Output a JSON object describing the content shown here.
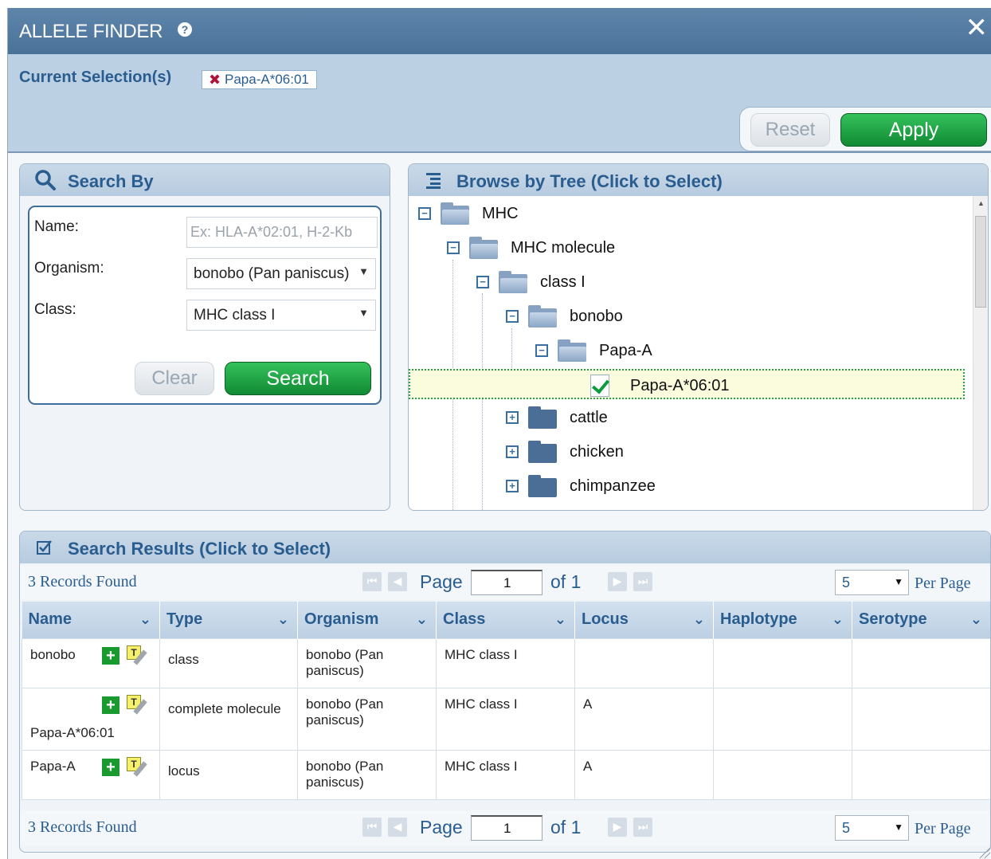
{
  "dialog": {
    "title": "ALLELE FINDER"
  },
  "selection": {
    "label": "Current Selection(s)",
    "chips": [
      "Papa-A*06:01"
    ]
  },
  "actions": {
    "reset": "Reset",
    "apply": "Apply"
  },
  "search_by": {
    "title": "Search By",
    "name_label": "Name:",
    "name_placeholder": "Ex: HLA-A*02:01, H-2-Kb",
    "name_value": "",
    "organism_label": "Organism:",
    "organism_value": "bonobo (Pan paniscus)",
    "class_label": "Class:",
    "class_value": "MHC class I",
    "clear": "Clear",
    "search": "Search"
  },
  "tree": {
    "title": "Browse by Tree (Click to Select)",
    "nodes": [
      {
        "label": "MHC",
        "level": 0,
        "state": "expanded"
      },
      {
        "label": "MHC molecule",
        "level": 1,
        "state": "expanded"
      },
      {
        "label": "class I",
        "level": 2,
        "state": "expanded"
      },
      {
        "label": "bonobo",
        "level": 3,
        "state": "expanded"
      },
      {
        "label": "Papa-A",
        "level": 4,
        "state": "expanded"
      },
      {
        "label": "Papa-A*06:01",
        "level": 5,
        "state": "leaf-selected"
      },
      {
        "label": "cattle",
        "level": 3,
        "state": "collapsed"
      },
      {
        "label": "chicken",
        "level": 3,
        "state": "collapsed"
      },
      {
        "label": "chimpanzee",
        "level": 3,
        "state": "collapsed"
      }
    ]
  },
  "results": {
    "title": "Search Results (Click to Select)",
    "records_found": "3 Records Found",
    "page_label": "Page",
    "page_value": "1",
    "of_label": "of 1",
    "per_page_value": "5",
    "per_page_label": "Per Page",
    "columns": [
      "Name",
      "Type",
      "Organism",
      "Class",
      "Locus",
      "Haplotype",
      "Serotype"
    ],
    "rows": [
      {
        "name": "bonobo",
        "type": "class",
        "organism": "bonobo (Pan paniscus)",
        "class": "MHC class I",
        "locus": "",
        "haplotype": "",
        "serotype": ""
      },
      {
        "name": "Papa-A*06:01",
        "type": "complete molecule",
        "organism": "bonobo (Pan paniscus)",
        "class": "MHC class I",
        "locus": "A",
        "haplotype": "",
        "serotype": ""
      },
      {
        "name": "Papa-A",
        "type": "locus",
        "organism": "bonobo (Pan paniscus)",
        "class": "MHC class I",
        "locus": "A",
        "haplotype": "",
        "serotype": ""
      }
    ]
  },
  "colors": {
    "title_bar": "#4a7299",
    "panel_header_text": "#2a5d8f",
    "primary_button": "#1a9a3e",
    "selection_outline": "#23a24a"
  }
}
